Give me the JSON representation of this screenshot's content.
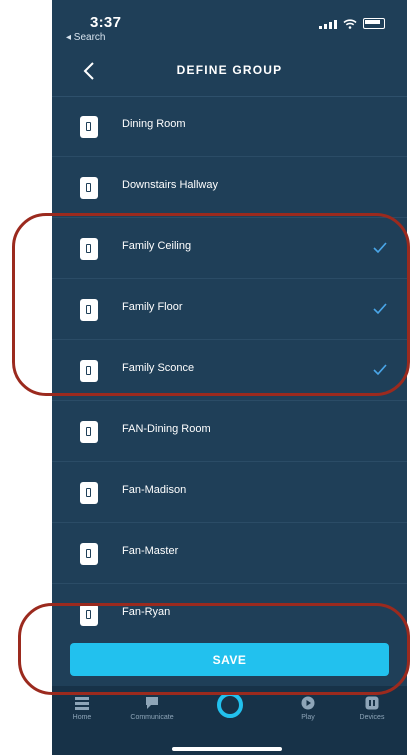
{
  "status_bar": {
    "time": "3:37",
    "back_app": "◂ Search"
  },
  "nav": {
    "title": "DEFINE GROUP"
  },
  "devices": [
    {
      "label": "Dining Room",
      "selected": false
    },
    {
      "label": "Downstairs Hallway",
      "selected": false
    },
    {
      "label": "Family Ceiling",
      "selected": true
    },
    {
      "label": "Family Floor",
      "selected": true
    },
    {
      "label": "Family Sconce",
      "selected": true
    },
    {
      "label": "FAN-Dining Room",
      "selected": false
    },
    {
      "label": "Fan-Madison",
      "selected": false
    },
    {
      "label": "Fan-Master",
      "selected": false
    },
    {
      "label": "Fan-Ryan",
      "selected": false
    }
  ],
  "save_label": "SAVE",
  "tabs": [
    {
      "label": "Home",
      "icon": "home-icon"
    },
    {
      "label": "Communicate",
      "icon": "chat-icon"
    },
    {
      "label": "",
      "icon": "alexa-ring-icon"
    },
    {
      "label": "Play",
      "icon": "play-icon"
    },
    {
      "label": "Devices",
      "icon": "devices-icon"
    }
  ],
  "colors": {
    "background": "#1f3f58",
    "accent": "#22c1ee",
    "check": "#4aa6e8",
    "annotation": "#9b2a1e"
  }
}
